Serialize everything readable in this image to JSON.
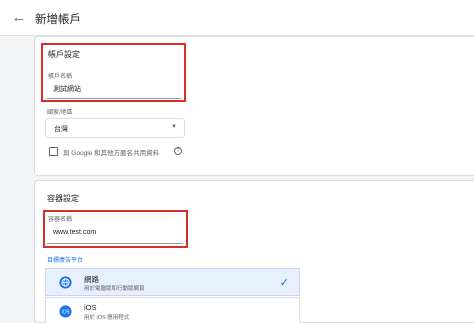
{
  "header": {
    "back_icon": "arrow-left-icon",
    "title": "新增帳戶"
  },
  "account": {
    "section_title": "帳戶設定",
    "name_label": "帳戶名稱",
    "name_value": "測試網站",
    "country_label": "國家/地區",
    "country_value": "台灣",
    "share_label": "與 Google 和其他方匿名共用資料"
  },
  "container": {
    "section_title": "容器設定",
    "name_label": "容器名稱",
    "name_value": "www.test.com",
    "target_label": "目標廣告平台",
    "platforms": [
      {
        "name": "網路",
        "desc": "用於電腦版和行動版網頁",
        "selected": true,
        "icon": "globe-icon"
      },
      {
        "name": "iOS",
        "desc": "用於 iOS 應用程式",
        "selected": false,
        "icon": "ios-icon"
      }
    ]
  },
  "colors": {
    "accent": "#1a73e8",
    "highlight": "#d93025"
  }
}
